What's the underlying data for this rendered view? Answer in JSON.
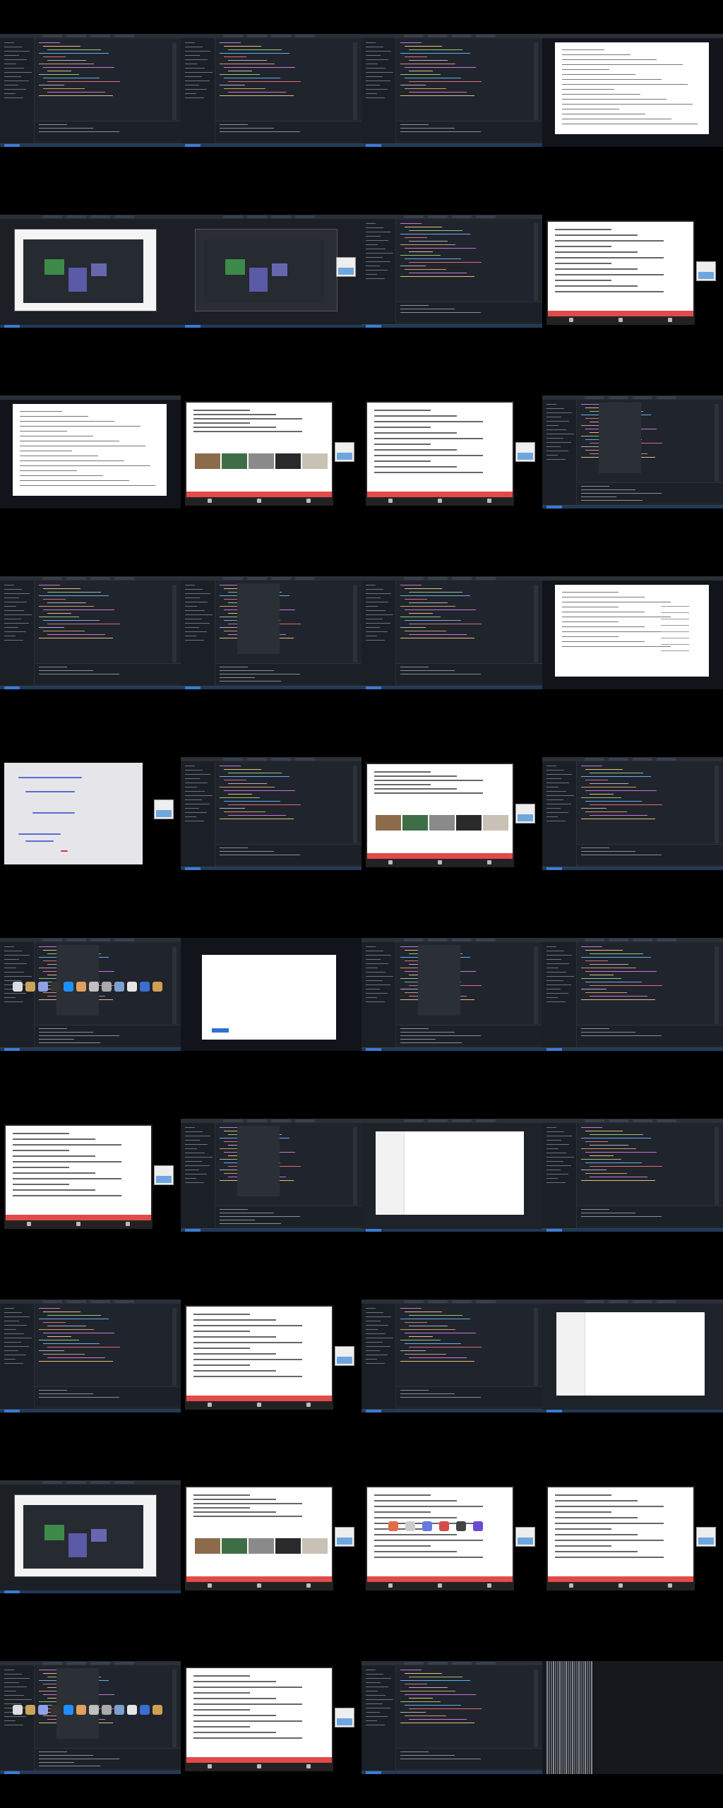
{
  "grid": {
    "cols": 4,
    "rows": 10,
    "row_gap": 96,
    "tile_w": 256,
    "tile_h": 160
  },
  "rows": [
    {
      "tiles": [
        {
          "type": "ide"
        },
        {
          "type": "ide"
        },
        {
          "type": "ide"
        },
        {
          "type": "webdoc"
        }
      ]
    },
    {
      "tiles": [
        {
          "type": "webapp"
        },
        {
          "type": "webapp_dark"
        },
        {
          "type": "ide"
        },
        {
          "type": "slide"
        }
      ]
    },
    {
      "tiles": [
        {
          "type": "webdoc"
        },
        {
          "type": "slide_img"
        },
        {
          "type": "slide"
        },
        {
          "type": "ide_panel"
        }
      ]
    },
    {
      "tiles": [
        {
          "type": "ide"
        },
        {
          "type": "ide_panel"
        },
        {
          "type": "ide"
        },
        {
          "type": "webdoc_table"
        }
      ]
    },
    {
      "tiles": [
        {
          "type": "handwriting"
        },
        {
          "type": "ide"
        },
        {
          "type": "slide_img"
        },
        {
          "type": "ide"
        }
      ]
    },
    {
      "tiles": [
        {
          "type": "dock"
        },
        {
          "type": "webcard"
        },
        {
          "type": "ide_panel"
        },
        {
          "type": "ide"
        }
      ]
    },
    {
      "tiles": [
        {
          "type": "slide"
        },
        {
          "type": "ide_panel"
        },
        {
          "type": "docs_sidebar"
        },
        {
          "type": "ide"
        }
      ]
    },
    {
      "tiles": [
        {
          "type": "ide"
        },
        {
          "type": "slide"
        },
        {
          "type": "ide"
        },
        {
          "type": "docs_sidebar"
        }
      ]
    },
    {
      "tiles": [
        {
          "type": "webapp"
        },
        {
          "type": "slide_img"
        },
        {
          "type": "slide_icons"
        },
        {
          "type": "slide"
        }
      ]
    },
    {
      "tiles": [
        {
          "type": "dock"
        },
        {
          "type": "slide"
        },
        {
          "type": "ide"
        },
        {
          "type": "terminal"
        }
      ]
    }
  ],
  "colors": {
    "bg": "#000000",
    "ide_bg": "#20242c",
    "sidebar_bg": "#1b1f26",
    "doc_bg": "#ffffff",
    "slide_red": "#e24a4a",
    "status_blue": "#1f3a5a",
    "status_accent": "#3a7bd5"
  },
  "icons": {
    "dock_apps": [
      "finder-icon",
      "notes-icon",
      "mail-icon",
      "terminal-icon",
      "safari-icon",
      "photos-icon",
      "calendar-icon",
      "messages-icon",
      "music-icon",
      "settings-icon",
      "app-store-icon",
      "preview-icon"
    ]
  }
}
